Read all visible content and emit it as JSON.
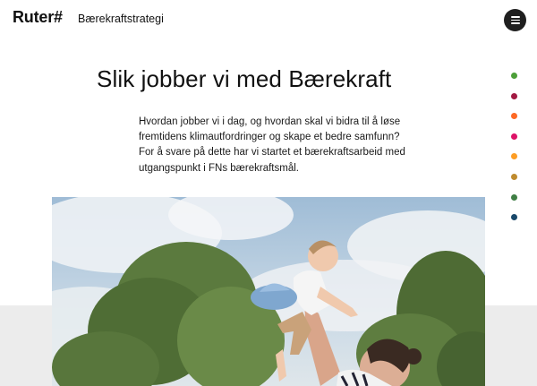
{
  "header": {
    "logo": "Ruter#",
    "section_title": "Bærekraftstrategi",
    "menu_icon": "hamburger-menu-icon"
  },
  "main": {
    "title": "Slik jobber vi med Bærekraft",
    "intro_lines": [
      "Hvordan jobber vi i dag, og hvordan skal vi bidra til å løse",
      "fremtidens klimautfordringer og skape et bedre samfunn?",
      "For å svare på dette har vi startet et bærekraftsarbeid med",
      "utgangspunkt i FNs bærekraftsmål."
    ]
  },
  "goal_nav": {
    "colors": [
      "#4c9f38",
      "#a21942",
      "#fd6925",
      "#dd1367",
      "#fd9d24",
      "#bf8b2e",
      "#3f7e44",
      "#19486a"
    ]
  },
  "hero_image": {
    "icon": "photo-parent-lifting-child"
  }
}
